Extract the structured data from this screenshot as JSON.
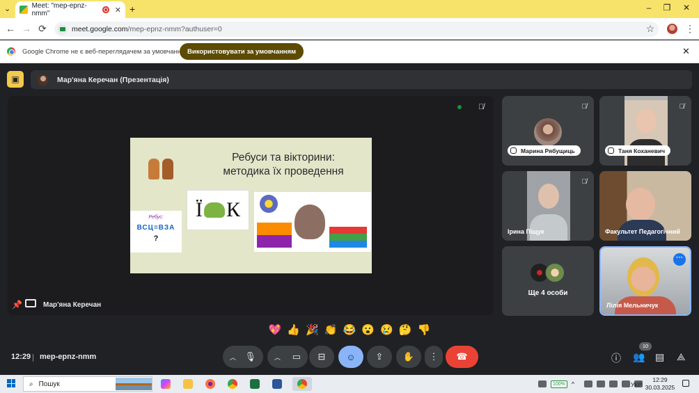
{
  "browser": {
    "tab_title": "Meet: \"mep-epnz-nmm\"",
    "close_tab": "✕",
    "new_tab": "+",
    "url_host": "meet.google.com",
    "url_path": "/mep-epnz-nmm?authuser=0",
    "window_controls": {
      "minimize": "–",
      "restore": "❐",
      "close": "✕"
    },
    "nav": {
      "back": "←",
      "forward": "→",
      "reload": "⟳",
      "star": "☆",
      "menu": "⋮"
    }
  },
  "infobar": {
    "message": "Google Chrome не є веб-переглядачем за умовчанням",
    "button": "Використовувати за умовчанням",
    "close": "✕"
  },
  "meet": {
    "presenter_bar": "Мар'яна Керечан (Презентація)",
    "stage_name": "Мар'яна Керечан",
    "slide": {
      "title_line1": "Ребуси та вікторини:",
      "title_line2": "методика їх проведення",
      "word_left": "Ї",
      "word_right": "К",
      "rebus_title": "Ребус:",
      "rebus_letters": "ВСЦ=ВЗА",
      "rebus_q": "?"
    },
    "participants": [
      {
        "name": "Марина Рябущиць",
        "muted": true
      },
      {
        "name": "Таня Коханевич",
        "muted": true
      },
      {
        "name": "Ірина Піщук",
        "muted": true
      },
      {
        "name": "Факультет Педагогічний",
        "muted": false
      },
      {
        "name": "Ще 4 особи",
        "muted": false
      },
      {
        "name": "Лілія Мельничук",
        "muted": false
      }
    ],
    "reactions": [
      "💖",
      "👍",
      "🎉",
      "👏",
      "😂",
      "😮",
      "😢",
      "🤔",
      "👎"
    ],
    "bottom": {
      "time": "12:29",
      "separator": "|",
      "meeting_code": "mep-epnz-nmm",
      "people_count": "10"
    }
  },
  "taskbar": {
    "search_label": "Пошук",
    "battery": "100%",
    "language": "УКР",
    "time": "12:29",
    "date": "30.03.2025"
  },
  "colors": {
    "tab_bar": "#f8e36a",
    "meet_bg": "#202124",
    "end_call": "#ea4335",
    "accent_blue": "#8ab4f8",
    "default_button": "#5c4b00"
  }
}
